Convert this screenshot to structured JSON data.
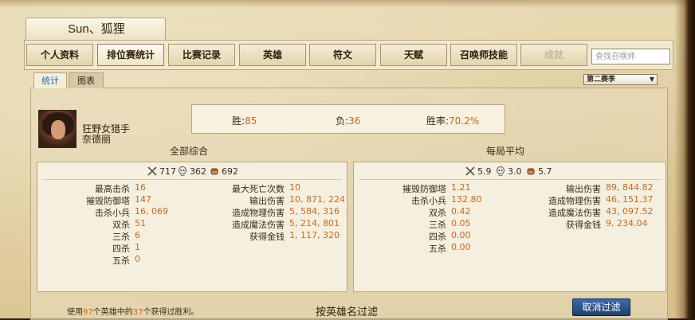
{
  "window": {
    "title": "Sun、狐狸"
  },
  "tabs": [
    {
      "label": "个人资料"
    },
    {
      "label": "排位赛统计"
    },
    {
      "label": "比赛记录"
    },
    {
      "label": "英雄"
    },
    {
      "label": "符文"
    },
    {
      "label": "天赋"
    },
    {
      "label": "召唤师技能"
    },
    {
      "label": "成就"
    }
  ],
  "search": {
    "placeholder": "查找召唤师"
  },
  "subtabs": [
    {
      "label": "统计"
    },
    {
      "label": "图表"
    }
  ],
  "season": {
    "selected": "第二赛季"
  },
  "champion": {
    "name": "狂野女猎手",
    "subname": "奈德丽"
  },
  "record": {
    "win_label": "胜:",
    "win_value": "85",
    "loss_label": "负:",
    "loss_value": "36",
    "rate_label": "胜率:",
    "rate_value": "70.2%"
  },
  "totals": {
    "title": "全部综合",
    "kills": "717",
    "deaths": "362",
    "assists": "692",
    "left": [
      {
        "label": "最高击杀",
        "value": "16"
      },
      {
        "label": "摧毁防御塔",
        "value": "147"
      },
      {
        "label": "击杀小兵",
        "value": "16, 069"
      },
      {
        "label": "双杀",
        "value": "51"
      },
      {
        "label": "三杀",
        "value": "6"
      },
      {
        "label": "四杀",
        "value": "1"
      },
      {
        "label": "五杀",
        "value": "0"
      }
    ],
    "right": [
      {
        "label": "最大死亡次数",
        "value": "10"
      },
      {
        "label": "输出伤害",
        "value": "10, 871, 224"
      },
      {
        "label": "造成物理伤害",
        "value": "5, 584, 316"
      },
      {
        "label": "造成魔法伤害",
        "value": "5, 214, 801"
      },
      {
        "label": "获得金钱",
        "value": "1, 117, 320"
      }
    ]
  },
  "averages": {
    "title": "每局平均",
    "kills": "5.9",
    "deaths": "3.0",
    "assists": "5.7",
    "left": [
      {
        "label": "摧毁防御塔",
        "value": "1.21"
      },
      {
        "label": "击杀小兵",
        "value": "132.80"
      },
      {
        "label": "双杀",
        "value": "0.42"
      },
      {
        "label": "三杀",
        "value": "0.05"
      },
      {
        "label": "四杀",
        "value": "0.00"
      },
      {
        "label": "五杀",
        "value": "0.00"
      }
    ],
    "right": [
      {
        "label": "输出伤害",
        "value": "89, 844.82"
      },
      {
        "label": "造成物理伤害",
        "value": "46, 151.37"
      },
      {
        "label": "造成魔法伤害",
        "value": "43, 097.52"
      },
      {
        "label": "获得金钱",
        "value": "9, 234.04"
      }
    ]
  },
  "footer": {
    "note_a": "使用",
    "note_n1": "97",
    "note_b": "个英雄中的",
    "note_n2": "37",
    "note_c": "个获得过胜利。",
    "filter_title": "按英雄名过滤",
    "clear_button": "取消过滤"
  },
  "icons": {
    "kills": "swords-icon",
    "deaths": "skull-icon",
    "assists": "fist-icon"
  },
  "colors": {
    "accent": "#c96a1e",
    "link": "#2e6aa8",
    "button": "#2a4f86"
  }
}
